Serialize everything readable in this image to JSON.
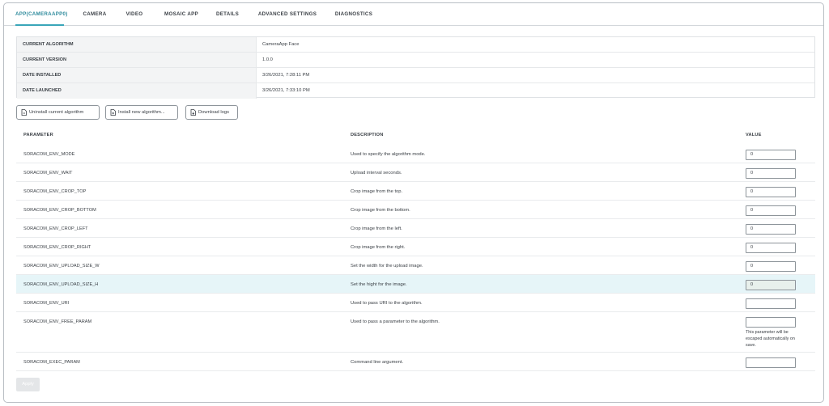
{
  "tabs": [
    {
      "label": "APP(CAMERAAPP0)"
    },
    {
      "label": "CAMERA"
    },
    {
      "label": "VIDEO"
    },
    {
      "label": "MOSAIC APP"
    },
    {
      "label": "DETAILS"
    },
    {
      "label": "ADVANCED SETTINGS"
    },
    {
      "label": "DIAGNOSTICS"
    }
  ],
  "info": [
    {
      "label": "CURRENT ALGORITHM",
      "value": "CameraApp Face"
    },
    {
      "label": "CURRENT VERSION",
      "value": "1.0.0"
    },
    {
      "label": "DATE INSTALLED",
      "value": "3/26/2021, 7:28:11 PM"
    },
    {
      "label": "DATE LAUNCHED",
      "value": "3/26/2021, 7:33:10 PM"
    }
  ],
  "actions": {
    "uninstall": "Uninstall current algorithm",
    "install": "Install new algorithm...",
    "download": "Download logs"
  },
  "params_header": {
    "parameter": "PARAMETER",
    "description": "DESCRIPTION",
    "value": "VALUE"
  },
  "params": [
    {
      "name": "SORACOM_ENV_MODE",
      "description": "Used to specify the algorithm mode.",
      "value": "0"
    },
    {
      "name": "SORACOM_ENV_WAIT",
      "description": "Upload interval seconds.",
      "value": "0"
    },
    {
      "name": "SORACOM_ENV_CROP_TOP",
      "description": "Crop image from the top.",
      "value": "0"
    },
    {
      "name": "SORACOM_ENV_CROP_BOTTOM",
      "description": "Crop image from the bottom.",
      "value": "0"
    },
    {
      "name": "SORACOM_ENV_CROP_LEFT",
      "description": "Crop image from the left.",
      "value": "0"
    },
    {
      "name": "SORACOM_ENV_CROP_RIGHT",
      "description": "Crop image from the right.",
      "value": "0"
    },
    {
      "name": "SORACOM_ENV_UPLOAD_SIZE_W",
      "description": "Set the width for the upload image.",
      "value": "0"
    },
    {
      "name": "SORACOM_ENV_UPLOAD_SIZE_H",
      "description": "Set the hight for the image.",
      "value": "0"
    },
    {
      "name": "SORACOM_ENV_URI",
      "description": "Used to pass URI to the algorithm.",
      "value": ""
    },
    {
      "name": "SORACOM_ENV_FREE_PARAM",
      "description": "Used to pass a parameter to the algorithm.",
      "value": "",
      "note": "This parameter will be escaped automatically on save."
    },
    {
      "name": "SORACOM_EXEC_PARAM",
      "description": "Command line argument.",
      "value": ""
    }
  ],
  "apply_label": "Apply",
  "colors": {
    "accent": "#3aa6b9",
    "highlight_row": "#e6f5f8"
  }
}
